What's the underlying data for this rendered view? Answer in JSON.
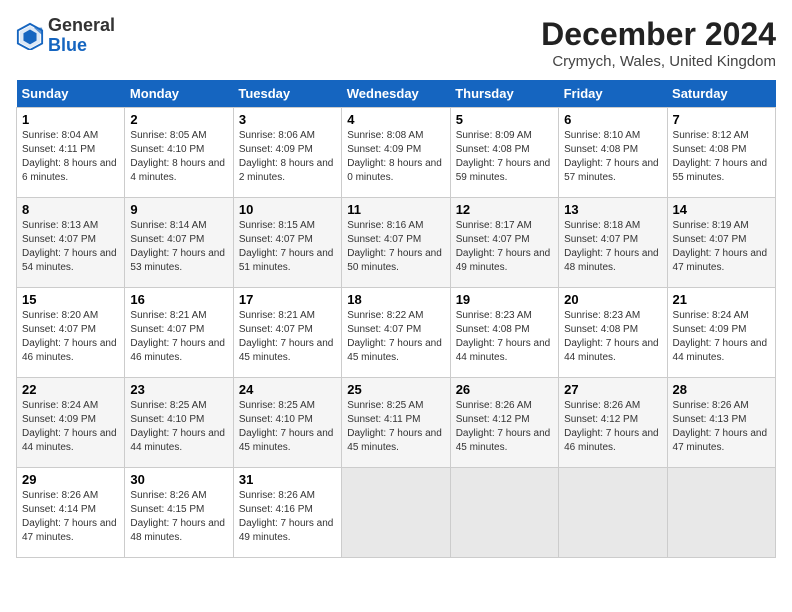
{
  "header": {
    "logo_general": "General",
    "logo_blue": "Blue",
    "month_title": "December 2024",
    "location": "Crymych, Wales, United Kingdom"
  },
  "weekdays": [
    "Sunday",
    "Monday",
    "Tuesday",
    "Wednesday",
    "Thursday",
    "Friday",
    "Saturday"
  ],
  "weeks": [
    [
      {
        "day": "1",
        "sunrise": "Sunrise: 8:04 AM",
        "sunset": "Sunset: 4:11 PM",
        "daylight": "Daylight: 8 hours and 6 minutes."
      },
      {
        "day": "2",
        "sunrise": "Sunrise: 8:05 AM",
        "sunset": "Sunset: 4:10 PM",
        "daylight": "Daylight: 8 hours and 4 minutes."
      },
      {
        "day": "3",
        "sunrise": "Sunrise: 8:06 AM",
        "sunset": "Sunset: 4:09 PM",
        "daylight": "Daylight: 8 hours and 2 minutes."
      },
      {
        "day": "4",
        "sunrise": "Sunrise: 8:08 AM",
        "sunset": "Sunset: 4:09 PM",
        "daylight": "Daylight: 8 hours and 0 minutes."
      },
      {
        "day": "5",
        "sunrise": "Sunrise: 8:09 AM",
        "sunset": "Sunset: 4:08 PM",
        "daylight": "Daylight: 7 hours and 59 minutes."
      },
      {
        "day": "6",
        "sunrise": "Sunrise: 8:10 AM",
        "sunset": "Sunset: 4:08 PM",
        "daylight": "Daylight: 7 hours and 57 minutes."
      },
      {
        "day": "7",
        "sunrise": "Sunrise: 8:12 AM",
        "sunset": "Sunset: 4:08 PM",
        "daylight": "Daylight: 7 hours and 55 minutes."
      }
    ],
    [
      {
        "day": "8",
        "sunrise": "Sunrise: 8:13 AM",
        "sunset": "Sunset: 4:07 PM",
        "daylight": "Daylight: 7 hours and 54 minutes."
      },
      {
        "day": "9",
        "sunrise": "Sunrise: 8:14 AM",
        "sunset": "Sunset: 4:07 PM",
        "daylight": "Daylight: 7 hours and 53 minutes."
      },
      {
        "day": "10",
        "sunrise": "Sunrise: 8:15 AM",
        "sunset": "Sunset: 4:07 PM",
        "daylight": "Daylight: 7 hours and 51 minutes."
      },
      {
        "day": "11",
        "sunrise": "Sunrise: 8:16 AM",
        "sunset": "Sunset: 4:07 PM",
        "daylight": "Daylight: 7 hours and 50 minutes."
      },
      {
        "day": "12",
        "sunrise": "Sunrise: 8:17 AM",
        "sunset": "Sunset: 4:07 PM",
        "daylight": "Daylight: 7 hours and 49 minutes."
      },
      {
        "day": "13",
        "sunrise": "Sunrise: 8:18 AM",
        "sunset": "Sunset: 4:07 PM",
        "daylight": "Daylight: 7 hours and 48 minutes."
      },
      {
        "day": "14",
        "sunrise": "Sunrise: 8:19 AM",
        "sunset": "Sunset: 4:07 PM",
        "daylight": "Daylight: 7 hours and 47 minutes."
      }
    ],
    [
      {
        "day": "15",
        "sunrise": "Sunrise: 8:20 AM",
        "sunset": "Sunset: 4:07 PM",
        "daylight": "Daylight: 7 hours and 46 minutes."
      },
      {
        "day": "16",
        "sunrise": "Sunrise: 8:21 AM",
        "sunset": "Sunset: 4:07 PM",
        "daylight": "Daylight: 7 hours and 46 minutes."
      },
      {
        "day": "17",
        "sunrise": "Sunrise: 8:21 AM",
        "sunset": "Sunset: 4:07 PM",
        "daylight": "Daylight: 7 hours and 45 minutes."
      },
      {
        "day": "18",
        "sunrise": "Sunrise: 8:22 AM",
        "sunset": "Sunset: 4:07 PM",
        "daylight": "Daylight: 7 hours and 45 minutes."
      },
      {
        "day": "19",
        "sunrise": "Sunrise: 8:23 AM",
        "sunset": "Sunset: 4:08 PM",
        "daylight": "Daylight: 7 hours and 44 minutes."
      },
      {
        "day": "20",
        "sunrise": "Sunrise: 8:23 AM",
        "sunset": "Sunset: 4:08 PM",
        "daylight": "Daylight: 7 hours and 44 minutes."
      },
      {
        "day": "21",
        "sunrise": "Sunrise: 8:24 AM",
        "sunset": "Sunset: 4:09 PM",
        "daylight": "Daylight: 7 hours and 44 minutes."
      }
    ],
    [
      {
        "day": "22",
        "sunrise": "Sunrise: 8:24 AM",
        "sunset": "Sunset: 4:09 PM",
        "daylight": "Daylight: 7 hours and 44 minutes."
      },
      {
        "day": "23",
        "sunrise": "Sunrise: 8:25 AM",
        "sunset": "Sunset: 4:10 PM",
        "daylight": "Daylight: 7 hours and 44 minutes."
      },
      {
        "day": "24",
        "sunrise": "Sunrise: 8:25 AM",
        "sunset": "Sunset: 4:10 PM",
        "daylight": "Daylight: 7 hours and 45 minutes."
      },
      {
        "day": "25",
        "sunrise": "Sunrise: 8:25 AM",
        "sunset": "Sunset: 4:11 PM",
        "daylight": "Daylight: 7 hours and 45 minutes."
      },
      {
        "day": "26",
        "sunrise": "Sunrise: 8:26 AM",
        "sunset": "Sunset: 4:12 PM",
        "daylight": "Daylight: 7 hours and 45 minutes."
      },
      {
        "day": "27",
        "sunrise": "Sunrise: 8:26 AM",
        "sunset": "Sunset: 4:12 PM",
        "daylight": "Daylight: 7 hours and 46 minutes."
      },
      {
        "day": "28",
        "sunrise": "Sunrise: 8:26 AM",
        "sunset": "Sunset: 4:13 PM",
        "daylight": "Daylight: 7 hours and 47 minutes."
      }
    ],
    [
      {
        "day": "29",
        "sunrise": "Sunrise: 8:26 AM",
        "sunset": "Sunset: 4:14 PM",
        "daylight": "Daylight: 7 hours and 47 minutes."
      },
      {
        "day": "30",
        "sunrise": "Sunrise: 8:26 AM",
        "sunset": "Sunset: 4:15 PM",
        "daylight": "Daylight: 7 hours and 48 minutes."
      },
      {
        "day": "31",
        "sunrise": "Sunrise: 8:26 AM",
        "sunset": "Sunset: 4:16 PM",
        "daylight": "Daylight: 7 hours and 49 minutes."
      },
      null,
      null,
      null,
      null
    ]
  ]
}
